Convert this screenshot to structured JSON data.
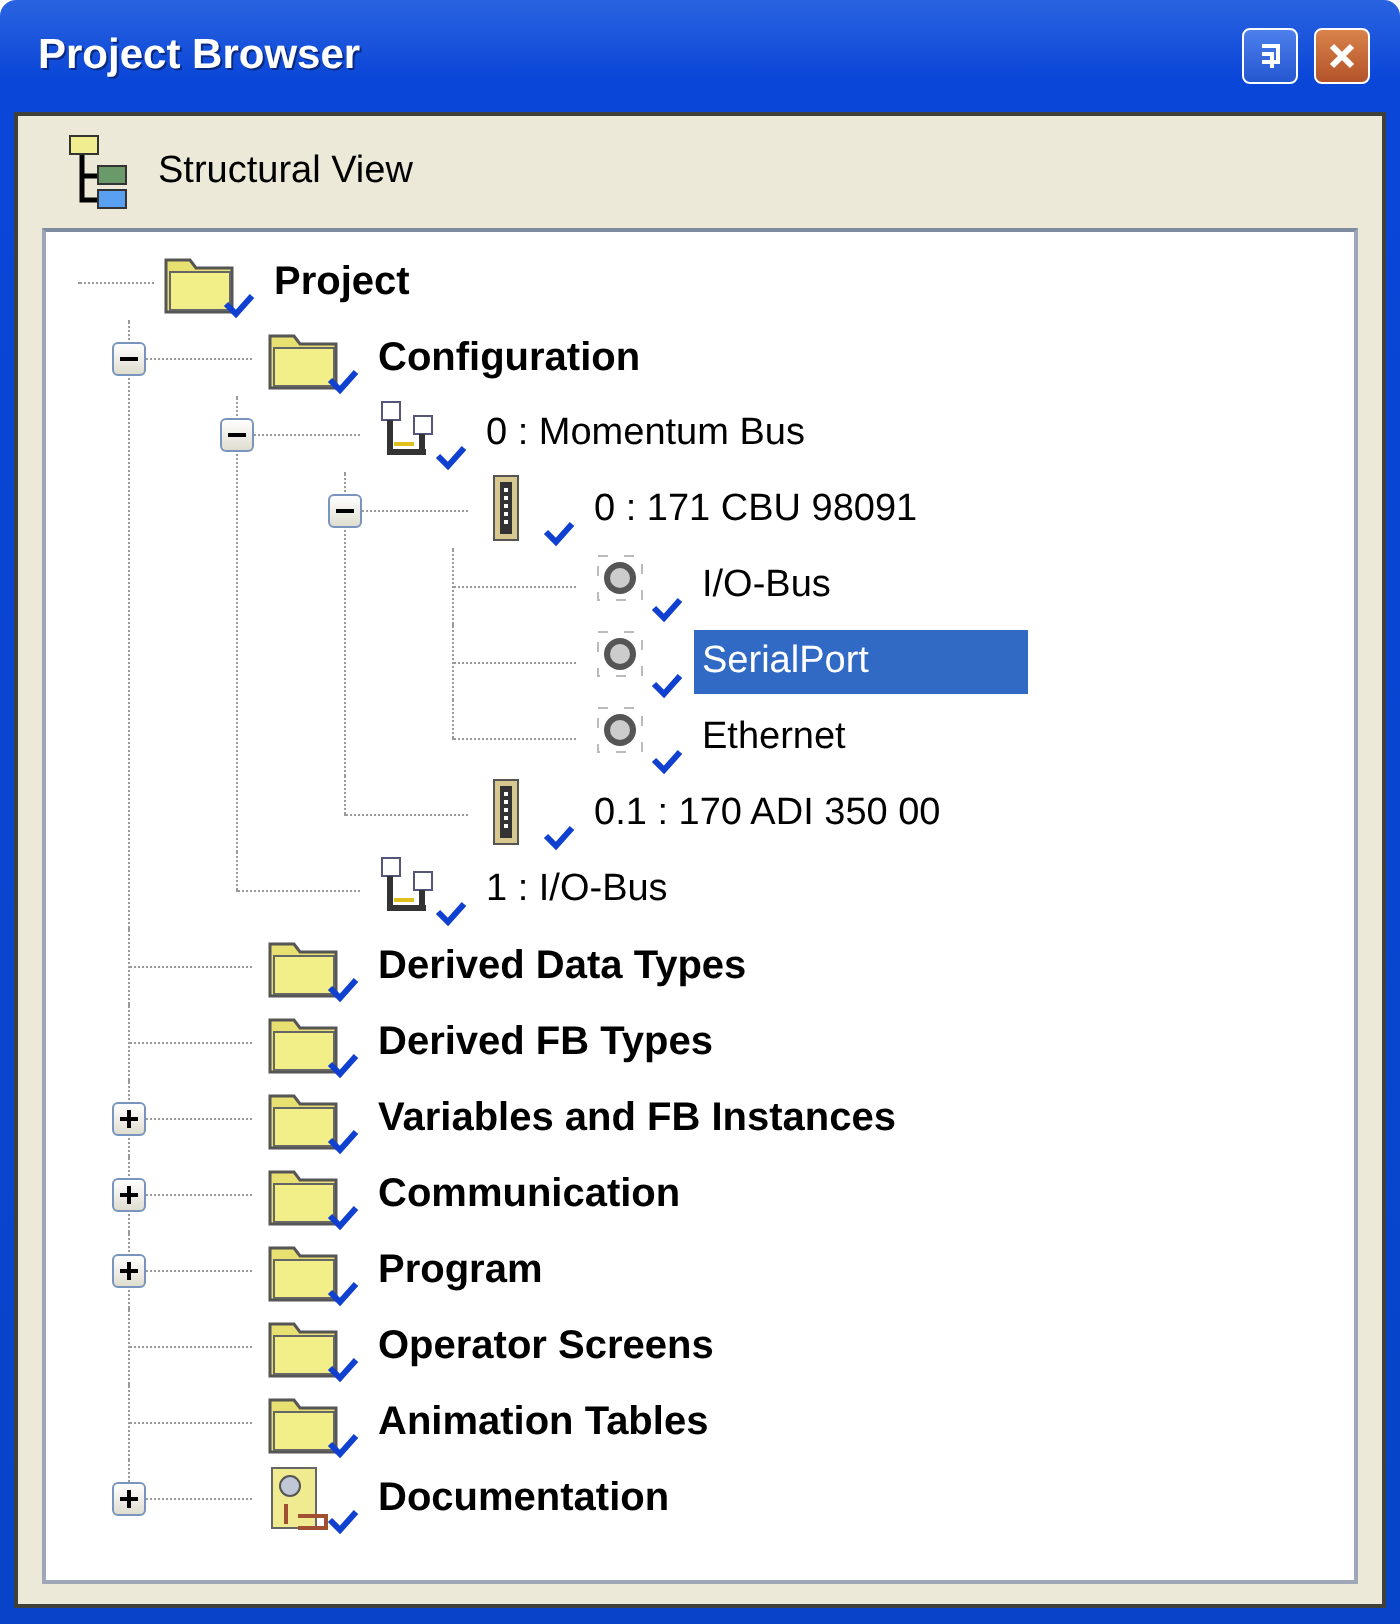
{
  "window": {
    "title": "Project Browser"
  },
  "view": {
    "label": "Structural View"
  },
  "tree": [
    {
      "label": "Project",
      "kind": "folder",
      "selected": false,
      "children": [
        {
          "label": "Configuration",
          "kind": "folder",
          "selected": false,
          "expanded": true,
          "children": [
            {
              "label": "0 : Momentum Bus",
              "kind": "bus",
              "selected": false,
              "expanded": true,
              "children": [
                {
                  "label": "0 : 171 CBU 98091",
                  "kind": "module",
                  "selected": false,
                  "expanded": true,
                  "children": [
                    {
                      "label": "I/O-Bus",
                      "kind": "port",
                      "selected": false
                    },
                    {
                      "label": "SerialPort",
                      "kind": "port",
                      "selected": true
                    },
                    {
                      "label": "Ethernet",
                      "kind": "port",
                      "selected": false
                    }
                  ]
                },
                {
                  "label": "0.1 : 170 ADI 350 00",
                  "kind": "module",
                  "selected": false
                }
              ]
            },
            {
              "label": "1 : I/O-Bus",
              "kind": "bus",
              "selected": false
            }
          ]
        },
        {
          "label": "Derived Data Types",
          "kind": "folder",
          "selected": false
        },
        {
          "label": "Derived FB Types",
          "kind": "folder",
          "selected": false
        },
        {
          "label": "Variables and FB Instances",
          "kind": "folder",
          "selected": false,
          "expanded": false
        },
        {
          "label": "Communication",
          "kind": "folder",
          "selected": false,
          "expanded": false
        },
        {
          "label": "Program",
          "kind": "folder",
          "selected": false,
          "expanded": false
        },
        {
          "label": "Operator Screens",
          "kind": "folder",
          "selected": false
        },
        {
          "label": "Animation Tables",
          "kind": "folder",
          "selected": false
        },
        {
          "label": "Documentation",
          "kind": "doc",
          "selected": false,
          "expanded": false
        }
      ]
    }
  ]
}
